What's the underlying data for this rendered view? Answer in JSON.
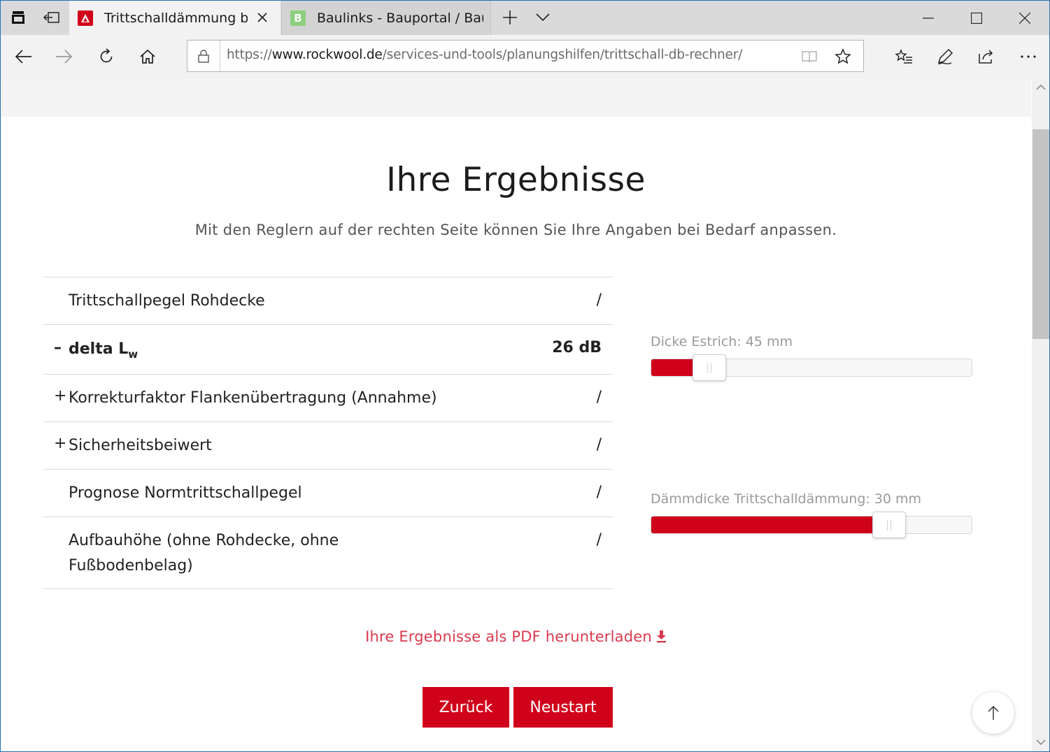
{
  "browser": {
    "tabs": [
      {
        "title": "Trittschalldämmung ber",
        "active": true,
        "favicon": "rockwool-logo-icon"
      },
      {
        "title": "Baulinks - Bauportal / Baum",
        "active": false,
        "favicon": "baulinks-b-icon"
      }
    ],
    "url": {
      "scheme": "https://",
      "domain": "www.rockwool.de",
      "path": "/services-und-tools/planungshilfen/trittschall-db-rechner/"
    }
  },
  "page": {
    "title": "Ihre Ergebnisse",
    "subtitle": "Mit den Reglern auf der rechten Seite können Sie Ihre Angaben bei Bedarf anpassen.",
    "results": [
      {
        "sign": "",
        "label": "Trittschallpegel Rohdecke",
        "value": "/"
      },
      {
        "sign": "–",
        "label": "delta L",
        "label_sub": "w",
        "value": "26 dB"
      },
      {
        "sign": "+",
        "label": "Korrekturfaktor Flankenübertragung (Annahme)",
        "value": "/"
      },
      {
        "sign": "+",
        "label": "Sicherheitsbeiwert",
        "value": "/"
      },
      {
        "sign": "",
        "label": "Prognose Normtrittschallpegel",
        "value": "/"
      },
      {
        "sign": "",
        "label_line1": "Aufbauhöhe (ohne Rohdecke, ohne",
        "label_line2": "Fußbodenbelag)",
        "value": "/"
      }
    ],
    "sliders": [
      {
        "label": "Dicke Estrich: 45 mm",
        "fraction": 0.18
      },
      {
        "label": "Dämmdicke Trittschalldämmung: 30 mm",
        "fraction": 0.74
      }
    ],
    "pdf_link": "Ihre Ergebnisse als PDF herunterladen",
    "buttons": {
      "back": "Zurück",
      "restart": "Neustart"
    }
  },
  "colors": {
    "accent": "#d0021b",
    "link": "#d83a4d"
  }
}
